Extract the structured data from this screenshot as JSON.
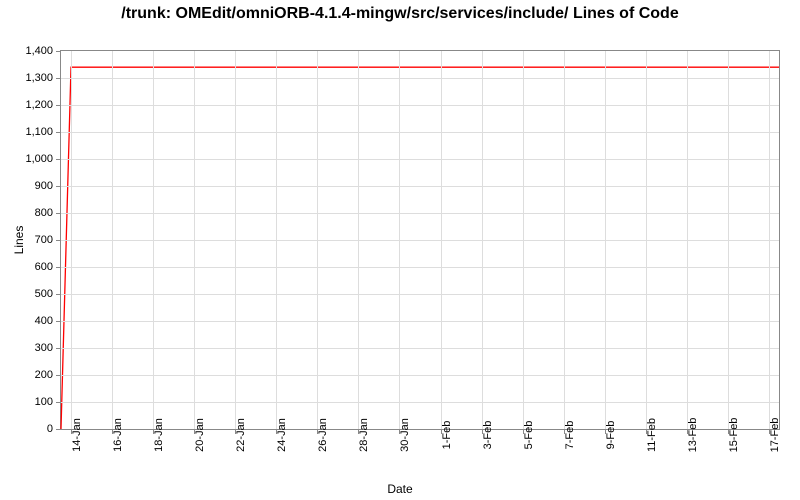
{
  "chart_data": {
    "type": "line",
    "title": "/trunk: OMEdit/omniORB-4.1.4-mingw/src/services/include/ Lines of Code",
    "xlabel": "Date",
    "ylabel": "Lines",
    "ylim": [
      0,
      1400
    ],
    "yticks": [
      0,
      100,
      200,
      300,
      400,
      500,
      600,
      700,
      800,
      900,
      1000,
      1100,
      1200,
      1300,
      1400
    ],
    "ytick_labels": [
      "0",
      "100",
      "200",
      "300",
      "400",
      "500",
      "600",
      "700",
      "800",
      "900",
      "1,000",
      "1,100",
      "1,200",
      "1,300",
      "1,400"
    ],
    "x_categories": [
      "14-Jan",
      "16-Jan",
      "18-Jan",
      "20-Jan",
      "22-Jan",
      "24-Jan",
      "26-Jan",
      "28-Jan",
      "30-Jan",
      "1-Feb",
      "3-Feb",
      "5-Feb",
      "7-Feb",
      "9-Feb",
      "11-Feb",
      "13-Feb",
      "15-Feb",
      "17-Feb"
    ],
    "series": [
      {
        "name": "Lines of Code",
        "color": "#ff0000",
        "x": [
          "13-Jan",
          "14-Jan",
          "17-Feb"
        ],
        "values": [
          0,
          1340,
          1340
        ]
      }
    ]
  }
}
